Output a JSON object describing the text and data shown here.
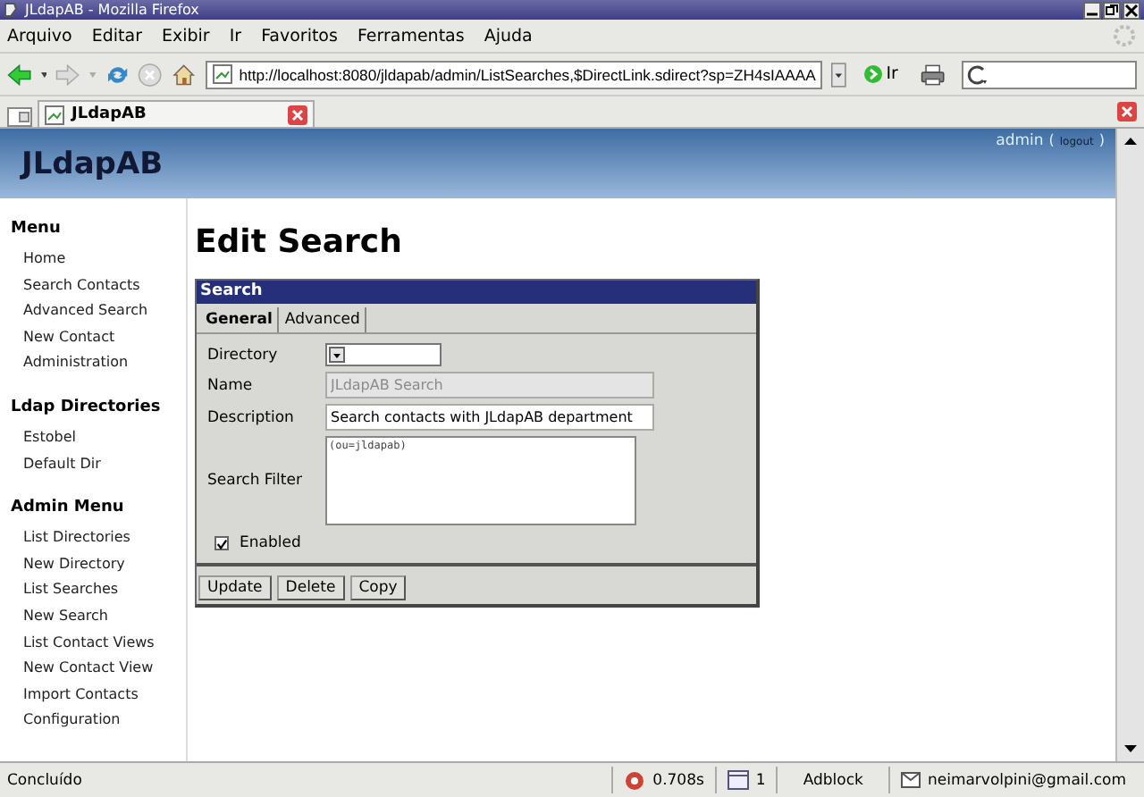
{
  "window": {
    "title": "JLdapAB - Mozilla Firefox"
  },
  "menu_bar": [
    "Arquivo",
    "Editar",
    "Exibir",
    "Ir",
    "Favoritos",
    "Ferramentas",
    "Ajuda"
  ],
  "toolbar": {
    "url": "http://localhost:8080/jldapab/admin/ListSearches,$DirectLink.sdirect?sp=ZH4sIAAAA",
    "go_label": "Ir"
  },
  "tabs": [
    {
      "label": "JLdapAB",
      "selected": true
    }
  ],
  "page": {
    "logo": "JLdapAB",
    "user": "admin",
    "logout_open": "(",
    "logout": "logout",
    "logout_close": ")",
    "sidebar": [
      {
        "title": "Menu",
        "items": [
          "Home",
          "Search Contacts",
          "Advanced Search",
          "New Contact",
          "Administration"
        ]
      },
      {
        "title": "Ldap Directories",
        "items": [
          "Estobel",
          "Default Dir"
        ]
      },
      {
        "title": "Admin Menu",
        "items": [
          "List Directories",
          "New Directory",
          "List Searches",
          "New Search",
          "List Contact Views",
          "New Contact View",
          "Import Contacts",
          "Configuration"
        ]
      }
    ],
    "heading": "Edit Search",
    "panel": {
      "title": "Search",
      "tabs": [
        {
          "label": "General",
          "selected": true
        },
        {
          "label": "Advanced",
          "selected": false
        }
      ],
      "fields": [
        {
          "kind": "select",
          "label": "Directory",
          "disabled": false
        },
        {
          "kind": "text",
          "label": "Name",
          "value": "JLdapAB Search",
          "disabled": true
        },
        {
          "kind": "text",
          "label": "Description",
          "value": "Search contacts with JLdapAB department",
          "disabled": false
        },
        {
          "kind": "textarea",
          "label": "Search Filter",
          "value": "(ou=jldapab)",
          "disabled": false
        }
      ],
      "checkbox": {
        "label": "Enabled",
        "checked": true
      },
      "buttons": [
        "Update",
        "Delete",
        "Copy"
      ]
    }
  },
  "status_bar": {
    "text": "Concluído",
    "timing": "0.708s",
    "count": "1",
    "adblock": "Adblock",
    "email": "neimarvolpini@gmail.com"
  }
}
